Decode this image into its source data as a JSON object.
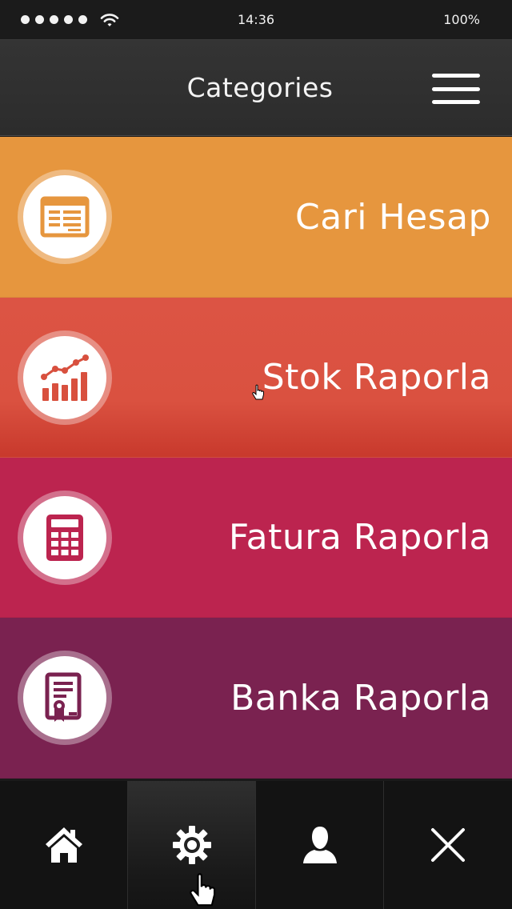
{
  "status_bar": {
    "time": "14:36",
    "battery": "100%",
    "signal_dots": 5,
    "wifi_icon": "wifi-icon"
  },
  "header": {
    "title": "Categories",
    "menu_icon": "hamburger-menu-icon"
  },
  "categories": [
    {
      "label": "Cari Hesap",
      "icon": "account-statement-icon",
      "color": "#E6963E",
      "icon_color": "#E6963E"
    },
    {
      "label": "Stok Raporla",
      "icon": "stock-chart-icon",
      "color": "#D94E3C",
      "icon_color": "#D8503E"
    },
    {
      "label": "Fatura Raporla",
      "icon": "calculator-icon",
      "color": "#BC244F",
      "icon_color": "#BC244F"
    },
    {
      "label": "Banka Raporla",
      "icon": "certificate-document-icon",
      "color": "#7A2250",
      "icon_color": "#7A2250"
    }
  ],
  "tabs": [
    {
      "name": "home",
      "icon": "home-icon",
      "active": false
    },
    {
      "name": "settings",
      "icon": "gear-icon",
      "active": true
    },
    {
      "name": "profile",
      "icon": "user-icon",
      "active": false
    },
    {
      "name": "close",
      "icon": "close-icon",
      "active": false
    }
  ]
}
